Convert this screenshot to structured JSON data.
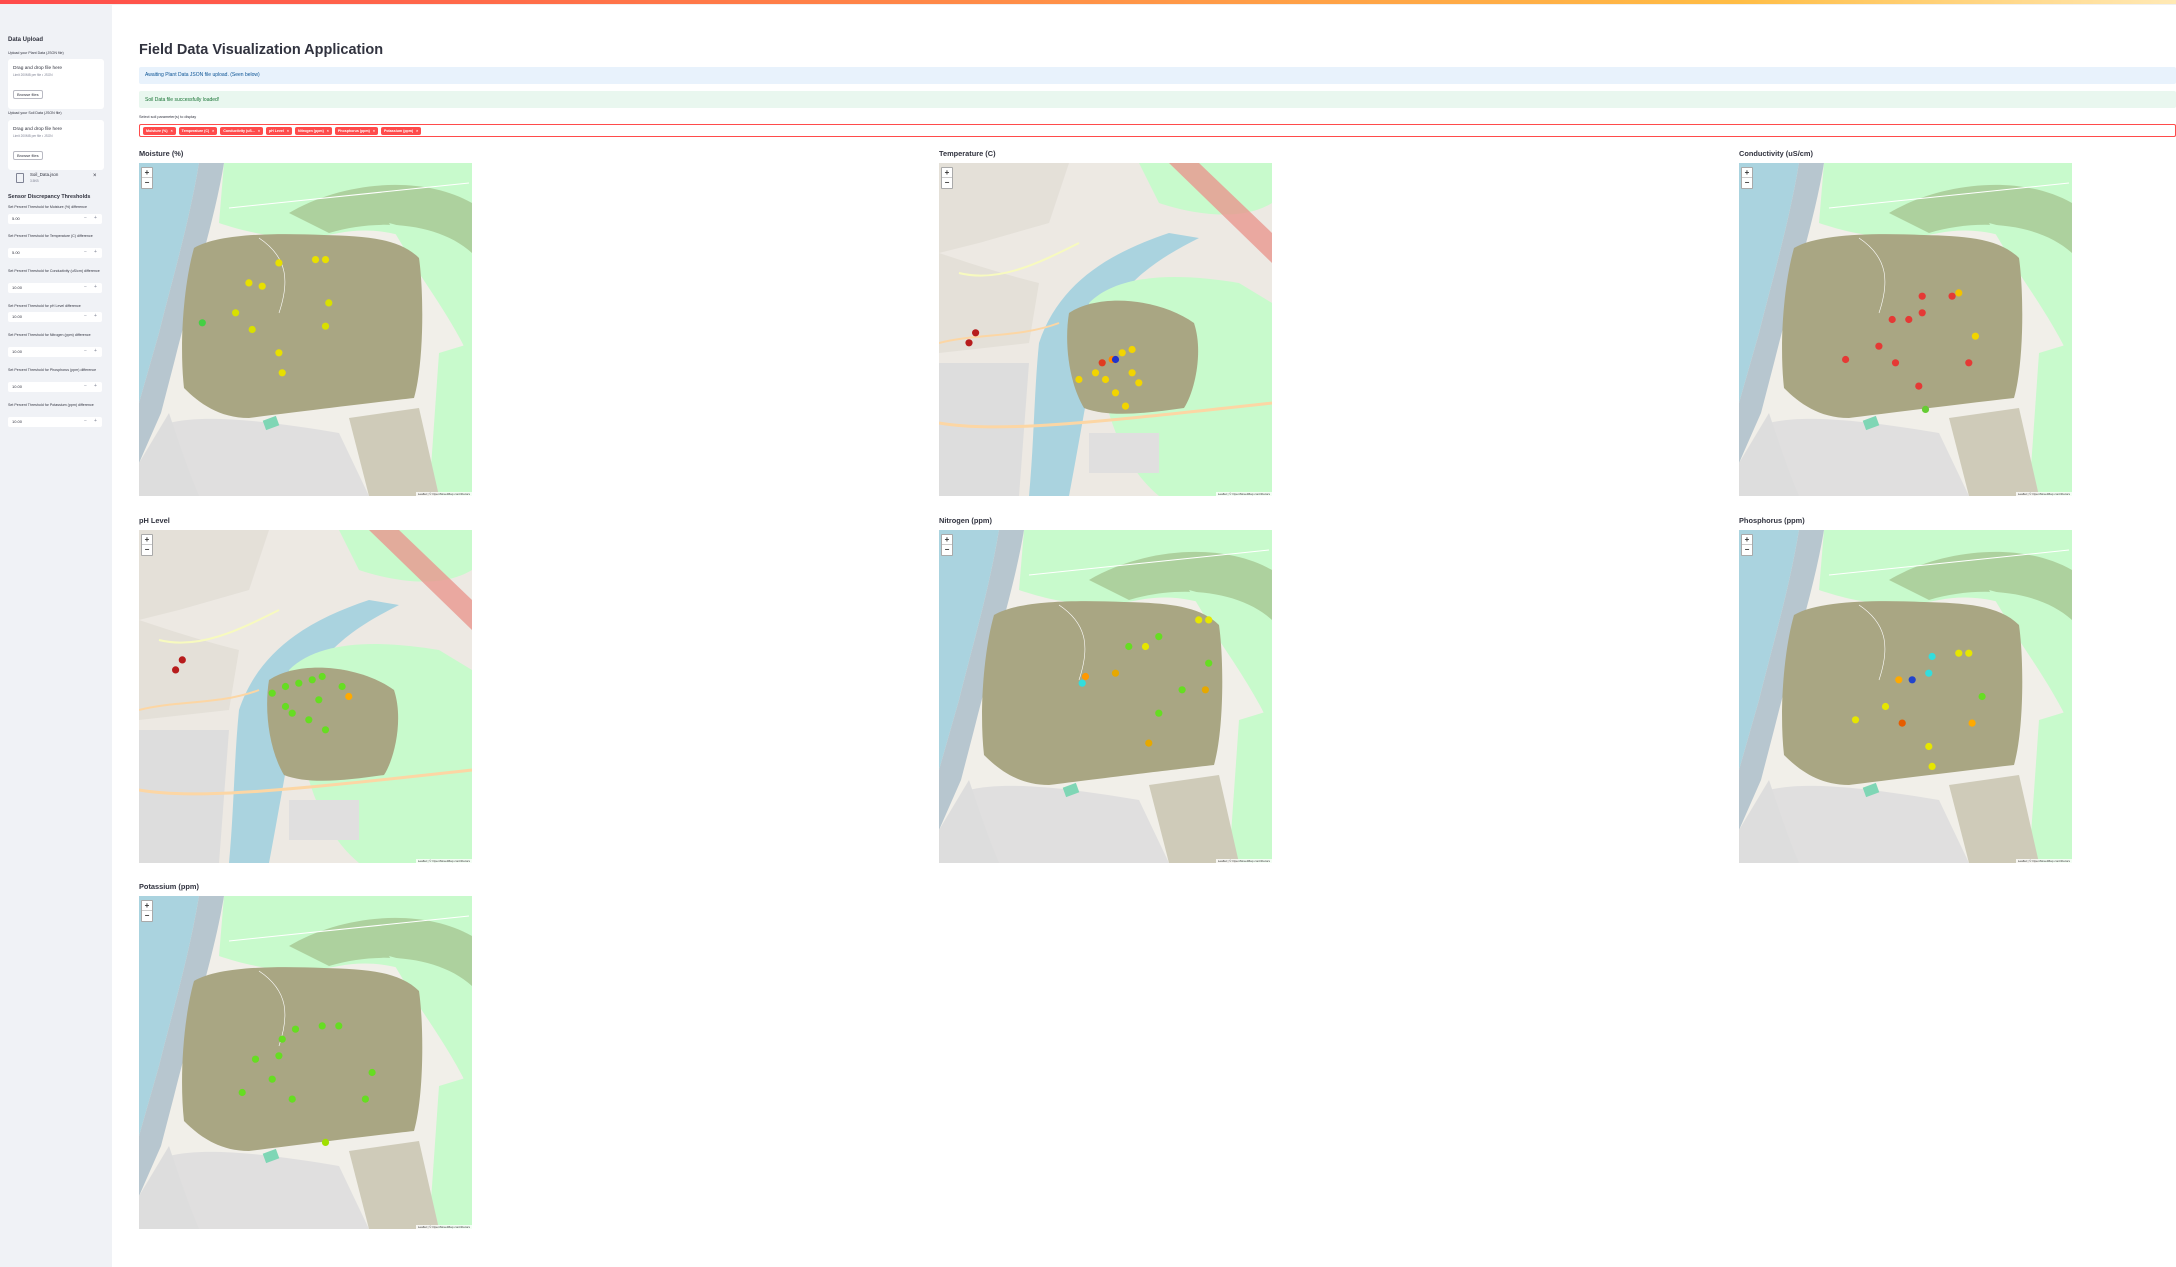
{
  "app": {
    "title": "Field Data Visualization Application"
  },
  "sidebar": {
    "upload_heading": "Data Upload",
    "uploaders": [
      {
        "label": "Upload your Plant Data (JSON file)",
        "drop_text": "Drag and drop file here",
        "limit_text": "Limit 200MB per file • JSON",
        "button": "Browse files"
      },
      {
        "label": "Upload your Soil Data (JSON file)",
        "drop_text": "Drag and drop file here",
        "limit_text": "Limit 200MB per file • JSON",
        "button": "Browse files"
      }
    ],
    "uploaded_file": {
      "name": "Soil_Data.json",
      "size": "3.5KB",
      "remove": "×"
    },
    "thresholds_heading": "Sensor Discrepancy Thresholds",
    "thresholds": [
      {
        "label": "Set Percent Threshold for Moisture (%) difference",
        "value": "5.00"
      },
      {
        "label": "Set Percent Threshold for Temperature (C) difference",
        "value": "5.00"
      },
      {
        "label": "Set Percent Threshold for Conductivity (uS/cm) difference",
        "value": "10.00"
      },
      {
        "label": "Set Percent Threshold for pH Level difference",
        "value": "10.00"
      },
      {
        "label": "Set Percent Threshold for Nitrogen (ppm) difference",
        "value": "10.00"
      },
      {
        "label": "Set Percent Threshold for Phosphorus (ppm) difference",
        "value": "10.00"
      },
      {
        "label": "Set Percent Threshold for Potassium (ppm) difference",
        "value": "10.00"
      }
    ],
    "stepper_minus": "−",
    "stepper_plus": "+"
  },
  "main": {
    "info_text": "Awaiting Plant Data JSON file upload. (Seen below)",
    "success_text": "Soil Data file successfully loaded!",
    "multiselect_label": "Select soil parameter(s) to display",
    "chips": [
      "Moisture (%)",
      "Temperature (C)",
      "Conductivity (uS...",
      "pH Level",
      "Nitrogen (ppm)",
      "Phosphorus (ppm)",
      "Potassium (ppm)"
    ],
    "chip_remove": "×",
    "zoom_in": "+",
    "zoom_out": "−",
    "attribution": "Leaflet | © OpenStreetMap contributors",
    "maps": [
      {
        "title": "Moisture (%)",
        "view": "close",
        "points": [
          {
            "u": 0.42,
            "v": 0.3,
            "c": "#e8e000"
          },
          {
            "u": 0.53,
            "v": 0.29,
            "c": "#e8e000"
          },
          {
            "u": 0.56,
            "v": 0.29,
            "c": "#e8e000"
          },
          {
            "u": 0.33,
            "v": 0.36,
            "c": "#e8e000"
          },
          {
            "u": 0.37,
            "v": 0.37,
            "c": "#e8e000"
          },
          {
            "u": 0.57,
            "v": 0.42,
            "c": "#d9e000"
          },
          {
            "u": 0.29,
            "v": 0.45,
            "c": "#d9e000"
          },
          {
            "u": 0.19,
            "v": 0.48,
            "c": "#44d044"
          },
          {
            "u": 0.34,
            "v": 0.5,
            "c": "#d9e000"
          },
          {
            "u": 0.56,
            "v": 0.49,
            "c": "#d9e000"
          },
          {
            "u": 0.42,
            "v": 0.57,
            "c": "#e8e000"
          },
          {
            "u": 0.43,
            "v": 0.63,
            "c": "#e8e000"
          }
        ]
      },
      {
        "title": "Temperature (C)",
        "view": "wide",
        "points": [
          {
            "u": 0.55,
            "v": 0.57,
            "c": "#f2d500"
          },
          {
            "u": 0.58,
            "v": 0.56,
            "c": "#f2d500"
          },
          {
            "u": 0.52,
            "v": 0.59,
            "c": "#ff8800"
          },
          {
            "u": 0.49,
            "v": 0.6,
            "c": "#e03b1f"
          },
          {
            "u": 0.53,
            "v": 0.59,
            "c": "#2233cc"
          },
          {
            "u": 0.47,
            "v": 0.63,
            "c": "#f2d500"
          },
          {
            "u": 0.42,
            "v": 0.65,
            "c": "#f2d500"
          },
          {
            "u": 0.5,
            "v": 0.65,
            "c": "#f2d500"
          },
          {
            "u": 0.58,
            "v": 0.63,
            "c": "#f2d500"
          },
          {
            "u": 0.6,
            "v": 0.66,
            "c": "#f2d500"
          },
          {
            "u": 0.53,
            "v": 0.69,
            "c": "#f2d500"
          },
          {
            "u": 0.56,
            "v": 0.73,
            "c": "#f2d500"
          },
          {
            "u": 0.11,
            "v": 0.51,
            "c": "#b71c1c"
          },
          {
            "u": 0.09,
            "v": 0.54,
            "c": "#b71c1c"
          }
        ]
      },
      {
        "title": "Conductivity (uS/cm)",
        "view": "close",
        "points": [
          {
            "u": 0.55,
            "v": 0.4,
            "c": "#e53935"
          },
          {
            "u": 0.64,
            "v": 0.4,
            "c": "#e53935"
          },
          {
            "u": 0.66,
            "v": 0.39,
            "c": "#f2c200"
          },
          {
            "u": 0.46,
            "v": 0.47,
            "c": "#e53935"
          },
          {
            "u": 0.51,
            "v": 0.47,
            "c": "#e53935"
          },
          {
            "u": 0.55,
            "v": 0.45,
            "c": "#e53935"
          },
          {
            "u": 0.71,
            "v": 0.52,
            "c": "#f2d500"
          },
          {
            "u": 0.42,
            "v": 0.55,
            "c": "#e53935"
          },
          {
            "u": 0.32,
            "v": 0.59,
            "c": "#e53935"
          },
          {
            "u": 0.47,
            "v": 0.6,
            "c": "#e53935"
          },
          {
            "u": 0.69,
            "v": 0.6,
            "c": "#e53935"
          },
          {
            "u": 0.54,
            "v": 0.67,
            "c": "#e53935"
          },
          {
            "u": 0.56,
            "v": 0.74,
            "c": "#66cc33"
          }
        ]
      },
      {
        "title": "pH Level",
        "view": "wide",
        "points": [
          {
            "u": 0.52,
            "v": 0.45,
            "c": "#66dd22"
          },
          {
            "u": 0.55,
            "v": 0.44,
            "c": "#66dd22"
          },
          {
            "u": 0.48,
            "v": 0.46,
            "c": "#66dd22"
          },
          {
            "u": 0.44,
            "v": 0.47,
            "c": "#66dd22"
          },
          {
            "u": 0.61,
            "v": 0.47,
            "c": "#66dd22"
          },
          {
            "u": 0.4,
            "v": 0.49,
            "c": "#66dd22"
          },
          {
            "u": 0.63,
            "v": 0.5,
            "c": "#ffaa00"
          },
          {
            "u": 0.54,
            "v": 0.51,
            "c": "#66dd22"
          },
          {
            "u": 0.44,
            "v": 0.53,
            "c": "#66dd22"
          },
          {
            "u": 0.46,
            "v": 0.55,
            "c": "#66dd22"
          },
          {
            "u": 0.51,
            "v": 0.57,
            "c": "#66dd22"
          },
          {
            "u": 0.56,
            "v": 0.6,
            "c": "#66dd22"
          },
          {
            "u": 0.13,
            "v": 0.39,
            "c": "#b71c1c"
          },
          {
            "u": 0.11,
            "v": 0.42,
            "c": "#b71c1c"
          }
        ]
      },
      {
        "title": "Nitrogen (ppm)",
        "view": "close",
        "points": [
          {
            "u": 0.78,
            "v": 0.27,
            "c": "#e6e600"
          },
          {
            "u": 0.81,
            "v": 0.27,
            "c": "#e6e600"
          },
          {
            "u": 0.66,
            "v": 0.32,
            "c": "#66dd22"
          },
          {
            "u": 0.57,
            "v": 0.35,
            "c": "#66dd22"
          },
          {
            "u": 0.62,
            "v": 0.35,
            "c": "#e6e600"
          },
          {
            "u": 0.81,
            "v": 0.4,
            "c": "#66dd22"
          },
          {
            "u": 0.53,
            "v": 0.43,
            "c": "#e6a800"
          },
          {
            "u": 0.44,
            "v": 0.44,
            "c": "#ff9900"
          },
          {
            "u": 0.73,
            "v": 0.48,
            "c": "#66dd22"
          },
          {
            "u": 0.43,
            "v": 0.46,
            "c": "#33dddd"
          },
          {
            "u": 0.8,
            "v": 0.48,
            "c": "#e6a800"
          },
          {
            "u": 0.66,
            "v": 0.55,
            "c": "#66dd22"
          },
          {
            "u": 0.63,
            "v": 0.64,
            "c": "#e6a800"
          }
        ]
      },
      {
        "title": "Phosphorus (ppm)",
        "view": "close",
        "points": [
          {
            "u": 0.66,
            "v": 0.37,
            "c": "#e6e600"
          },
          {
            "u": 0.69,
            "v": 0.37,
            "c": "#e6e600"
          },
          {
            "u": 0.58,
            "v": 0.38,
            "c": "#33dddd"
          },
          {
            "u": 0.57,
            "v": 0.43,
            "c": "#33dddd"
          },
          {
            "u": 0.48,
            "v": 0.45,
            "c": "#ffaa00"
          },
          {
            "u": 0.52,
            "v": 0.45,
            "c": "#2244cc"
          },
          {
            "u": 0.73,
            "v": 0.5,
            "c": "#66dd22"
          },
          {
            "u": 0.44,
            "v": 0.53,
            "c": "#e6e600"
          },
          {
            "u": 0.35,
            "v": 0.57,
            "c": "#e6e600"
          },
          {
            "u": 0.49,
            "v": 0.58,
            "c": "#e65c00"
          },
          {
            "u": 0.7,
            "v": 0.58,
            "c": "#ffaa00"
          },
          {
            "u": 0.57,
            "v": 0.65,
            "c": "#e6e600"
          },
          {
            "u": 0.58,
            "v": 0.71,
            "c": "#e6e600"
          }
        ]
      },
      {
        "title": "Potassium (ppm)",
        "view": "close",
        "points": [
          {
            "u": 0.55,
            "v": 0.39,
            "c": "#66dd22"
          },
          {
            "u": 0.6,
            "v": 0.39,
            "c": "#66dd22"
          },
          {
            "u": 0.47,
            "v": 0.4,
            "c": "#66dd22"
          },
          {
            "u": 0.43,
            "v": 0.43,
            "c": "#66dd22"
          },
          {
            "u": 0.35,
            "v": 0.49,
            "c": "#66dd22"
          },
          {
            "u": 0.42,
            "v": 0.48,
            "c": "#66dd22"
          },
          {
            "u": 0.7,
            "v": 0.53,
            "c": "#66dd22"
          },
          {
            "u": 0.4,
            "v": 0.55,
            "c": "#66dd22"
          },
          {
            "u": 0.31,
            "v": 0.59,
            "c": "#66dd22"
          },
          {
            "u": 0.46,
            "v": 0.61,
            "c": "#66dd22"
          },
          {
            "u": 0.68,
            "v": 0.61,
            "c": "#66dd22"
          },
          {
            "u": 0.56,
            "v": 0.74,
            "c": "#a0e000"
          }
        ]
      }
    ]
  }
}
